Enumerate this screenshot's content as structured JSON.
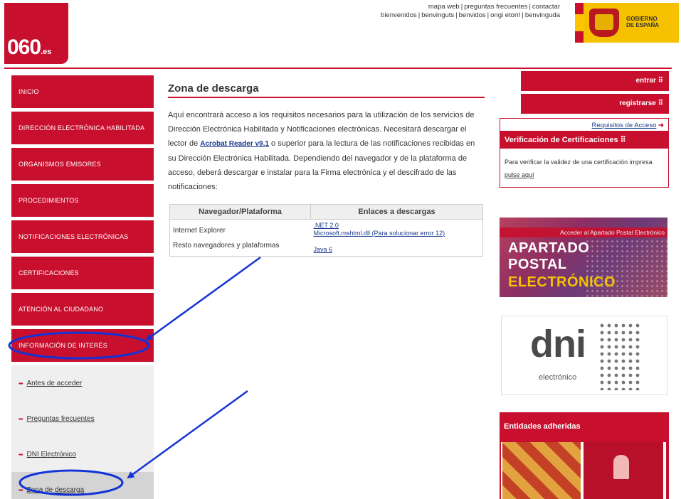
{
  "header": {
    "logo_main": "060",
    "logo_suffix": ".es",
    "top_links_row1": [
      "mapa web",
      "preguntas frecuentes",
      "contactar"
    ],
    "top_links_row2": [
      "bienvenidos",
      "benvinguts",
      "benvidos",
      "ongi etorri",
      "benvinguda"
    ],
    "gov_text_line1": "GOBIERNO",
    "gov_text_line2": "DE ESPAÑA"
  },
  "nav": {
    "items": [
      "INICIO",
      "DIRECCIÓN ELECTRÓNICA HABILITADA",
      "ORGANISMOS EMISORES",
      "PROCEDIMIENTOS",
      "NOTIFICACIONES ELECTRÓNICAS",
      "CERTIFICACIONES",
      "ATENCIÓN AL CIUDADANO",
      "INFORMACIÓN DE INTERÉS"
    ],
    "subitems": [
      "Antes de acceder",
      "Preguntas frecuentes",
      "DNI Electrónico",
      "Zona de descarga"
    ],
    "bullet": "▪▪▪"
  },
  "main": {
    "title": "Zona de descarga",
    "intro_part1": "Aquí encontrará acceso a los requisitos necesarios para la utilización de los servicios de Dirección Electrónica Habilitada y Notificaciones electrónicas. Necesitará descargar el lector de ",
    "intro_link": "Acrobat Reader v9.1",
    "intro_part2": " o superior para la lectura de las notificaciones recibidas en su Dirección Electrónica Habilitada. Dependiendo del navegador y de la plataforma de acceso, deberá descargar e instalar para la Firma electrónica y el descifrado de las notificaciones:",
    "table": {
      "headers": [
        "Navegador/Plataforma",
        "Enlaces a descargas"
      ],
      "row1_platform": "Internet Explorer",
      "row1_link1": ".NET 2.0",
      "row1_link2": "Microsoft.mshtml.dll (Para solucionar error 12)",
      "row2_platform": "Resto navegadores y plataformas",
      "row2_link1": "Java 6"
    }
  },
  "right": {
    "entrar": "entrar ⠿",
    "registrarse": "registrarse ⠿",
    "requisitos": "Requisitos de Acceso",
    "requisitos_arrow": "➜",
    "verif_title": "Verificación de Certificaciones ⠿",
    "verif_text": "Para verificar la validez de una certificación impresa ",
    "verif_link": "pulse aquí",
    "apartado_top": "Acceder al Apartado Postal Electrónico",
    "apartado_line1": "APARTADO",
    "apartado_line2": "POSTAL",
    "apartado_line3": "ELECTRÓNICO",
    "dni_word": "dni",
    "dni_sub": "electrónico",
    "entidades_title": "Entidades adheridas"
  },
  "colors": {
    "brand_red": "#c8102e",
    "annotation_blue": "#1433d6"
  }
}
